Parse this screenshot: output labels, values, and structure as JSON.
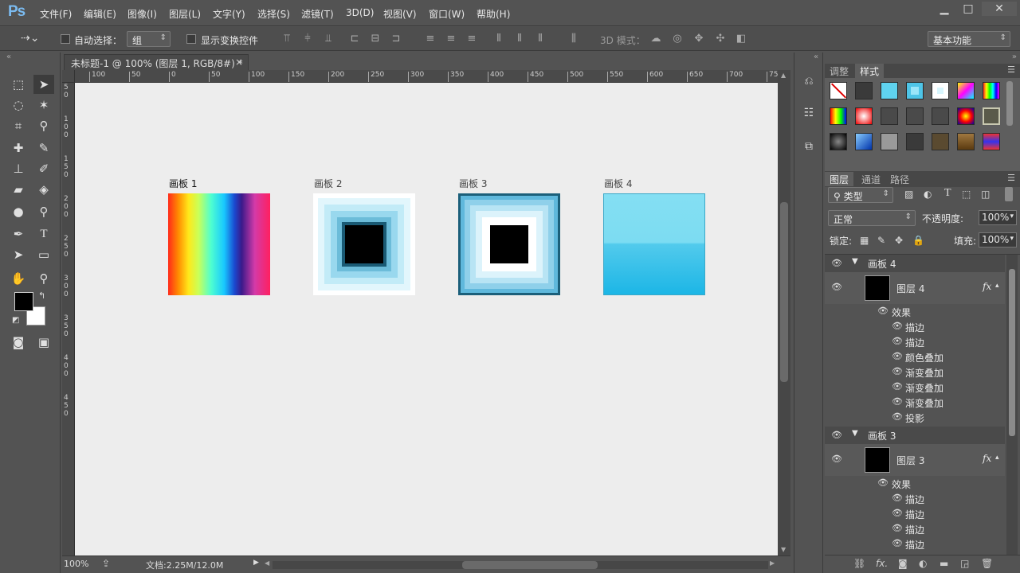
{
  "app": {
    "logo": "Ps"
  },
  "menu": [
    "文件(F)",
    "编辑(E)",
    "图像(I)",
    "图层(L)",
    "文字(Y)",
    "选择(S)",
    "滤镜(T)",
    "3D(D)",
    "视图(V)",
    "窗口(W)",
    "帮助(H)"
  ],
  "window_controls": {
    "minimize": "▁",
    "maximize": "□",
    "close": "✕"
  },
  "options_bar": {
    "auto_select_label": "自动选择：",
    "auto_select_value": "组",
    "show_transform_label": "显示变换控件",
    "mode_3d_label": "3D 模式：",
    "workspace": "基本功能"
  },
  "document": {
    "tab_title": "未标题-1 @ 100% (图层 1, RGB/8#) *",
    "close": "×",
    "h_ruler": [
      "100",
      "50",
      "0",
      "50",
      "100",
      "150",
      "200",
      "250",
      "300",
      "350",
      "400",
      "450",
      "500",
      "550",
      "600",
      "650",
      "700",
      "75"
    ],
    "v_ruler": [
      "5",
      "0",
      "1",
      "0",
      "0",
      "1",
      "5",
      "0",
      "2",
      "0",
      "0",
      "2",
      "5",
      "0",
      "3",
      "0",
      "0",
      "3",
      "5",
      "0",
      "4",
      "0",
      "0",
      "4",
      "5",
      "0"
    ],
    "artboards": [
      {
        "label": "画板 1",
        "type": "rainbow",
        "active": true
      },
      {
        "label": "画板 2",
        "type": "concentric-light"
      },
      {
        "label": "画板 3",
        "type": "concentric-dark"
      },
      {
        "label": "画板 4",
        "type": "cyan-gradient"
      }
    ]
  },
  "status": {
    "zoom": "100%",
    "doc_size": "文档:2.25M/12.0M"
  },
  "styles_panel": {
    "tabs": [
      "调整",
      "样式"
    ],
    "active_tab": "样式"
  },
  "layers_panel": {
    "tabs": [
      "图层",
      "通道",
      "路径"
    ],
    "active_tab": "图层",
    "filter_kind": "类型",
    "blend_mode": "正常",
    "opacity_label": "不透明度:",
    "opacity": "100%",
    "lock_label": "锁定:",
    "fill_label": "填充:",
    "fill": "100%",
    "groups": [
      {
        "name": "画板 4",
        "layer": "图层 4",
        "fx": "fx",
        "effects_label": "效果",
        "effects": [
          "描边",
          "描边",
          "颜色叠加",
          "渐变叠加",
          "渐变叠加",
          "渐变叠加",
          "投影"
        ]
      },
      {
        "name": "画板 3",
        "layer": "图层 3",
        "fx": "fx",
        "effects_label": "效果",
        "effects": [
          "描边",
          "描边",
          "描边",
          "描边"
        ]
      }
    ]
  },
  "colors": {
    "foreground": "#000000",
    "background": "#ffffff",
    "accent": "#7bbbf0"
  }
}
